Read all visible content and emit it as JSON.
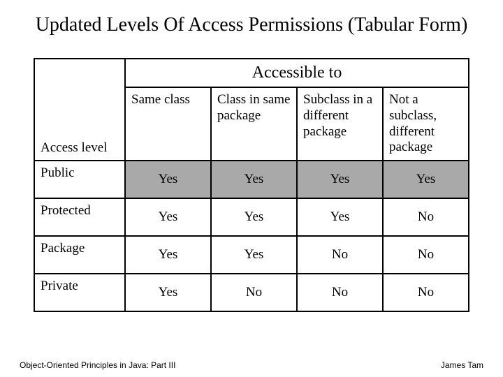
{
  "title": "Updated Levels Of Access Permissions (Tabular Form)",
  "table": {
    "accessible_to": "Accessible to",
    "access_level_label": "Access level",
    "columns": {
      "c1": "Same class",
      "c2": "Class in same package",
      "c3": "Subclass in a different package",
      "c4": "Not a subclass, different package"
    },
    "rows": [
      {
        "label": "Public",
        "values": [
          "Yes",
          "Yes",
          "Yes",
          "Yes"
        ],
        "shaded": true
      },
      {
        "label": "Protected",
        "values": [
          "Yes",
          "Yes",
          "Yes",
          "No"
        ],
        "shaded": false
      },
      {
        "label": "Package",
        "values": [
          "Yes",
          "Yes",
          "No",
          "No"
        ],
        "shaded": false
      },
      {
        "label": "Private",
        "values": [
          "Yes",
          "No",
          "No",
          "No"
        ],
        "shaded": false
      }
    ]
  },
  "footer": {
    "left": "Object-Oriented Principles in Java: Part III",
    "right": "James Tam"
  }
}
